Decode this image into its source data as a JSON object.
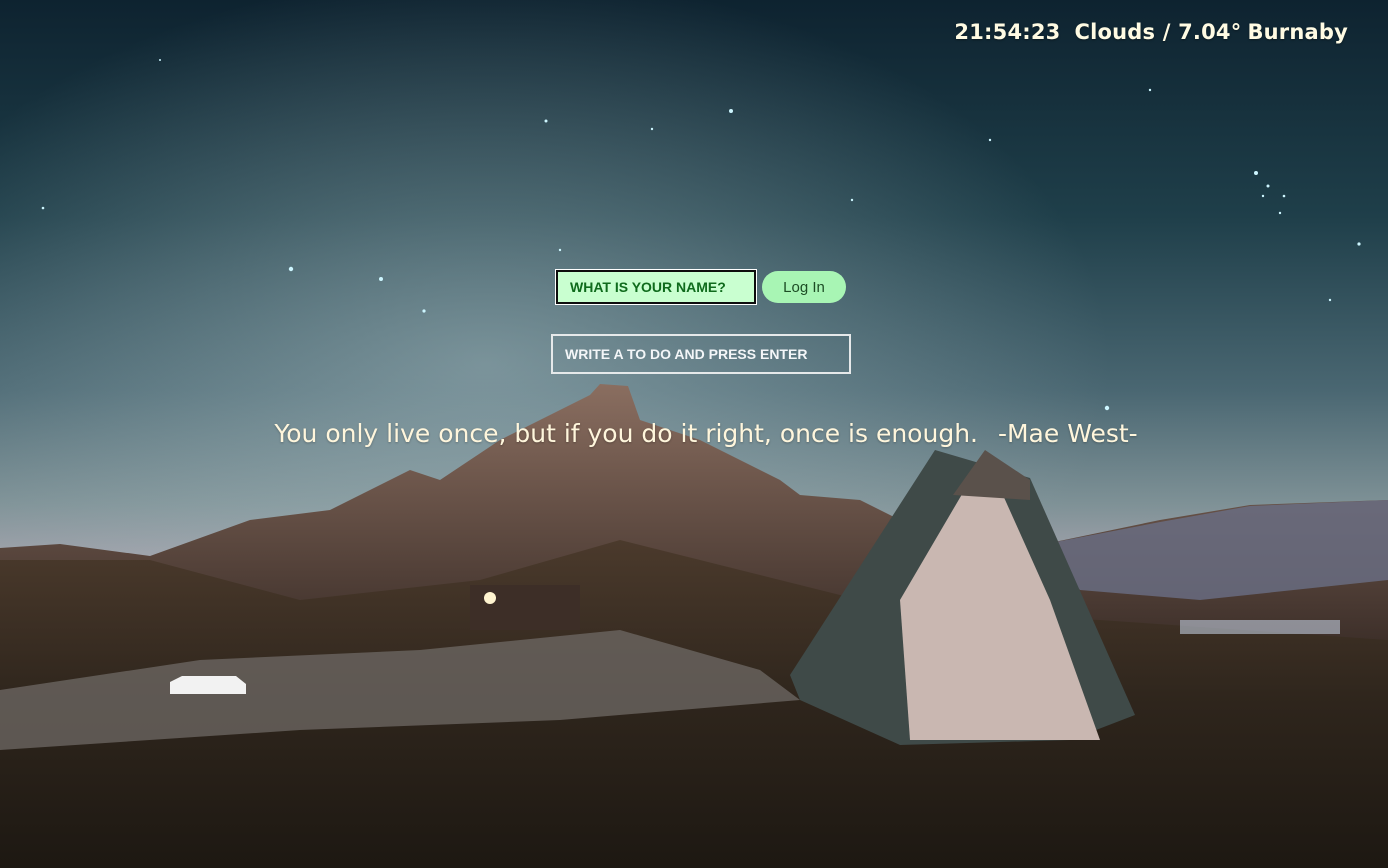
{
  "status": {
    "clock": "21:54:23",
    "weather": "Clouds / 7.04°",
    "city": "Burnaby"
  },
  "login": {
    "name_placeholder": "WHAT IS YOUR NAME?",
    "button_label": "Log In"
  },
  "todo": {
    "placeholder": "WRITE A TO DO AND PRESS ENTER"
  },
  "quote": {
    "text": "You only live once, but if you do it right, once is enough.",
    "author": "-Mae West-"
  },
  "colors": {
    "name_field_bg": "#c9ffd0",
    "name_field_text": "#0f6b1c",
    "login_button_bg": "#a8f5b4",
    "overlay_text": "#fffbe3"
  }
}
